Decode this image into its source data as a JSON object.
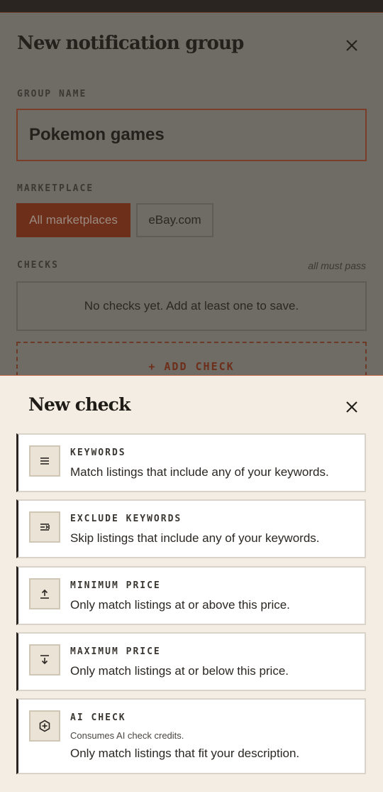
{
  "background_modal": {
    "title": "New notification group",
    "close_icon": "close-icon",
    "group_name_label": "GROUP NAME",
    "group_name_value": "Pokemon games",
    "marketplace_label": "MARKETPLACE",
    "marketplaces": [
      "All marketplaces",
      "eBay.com"
    ],
    "selected_marketplace": "All marketplaces",
    "checks_label": "CHECKS",
    "checks_hint": "all must pass",
    "empty_checks": "No checks yet. Add at least one to save.",
    "add_check": "+ ADD CHECK"
  },
  "sheet": {
    "title": "New check",
    "close_icon": "close-icon",
    "options": [
      {
        "name": "KEYWORDS",
        "description": "Match listings that include any of your keywords.",
        "icon": "list-icon"
      },
      {
        "name": "EXCLUDE KEYWORDS",
        "description": "Skip listings that include any of your keywords.",
        "icon": "exclude-list-icon"
      },
      {
        "name": "MINIMUM PRICE",
        "description": "Only match listings at or above this price.",
        "icon": "arrow-up-bar-icon"
      },
      {
        "name": "MAXIMUM PRICE",
        "description": "Only match listings at or below this price.",
        "icon": "arrow-down-bar-icon"
      },
      {
        "name": "AI CHECK",
        "note": "Consumes AI check credits.",
        "description": "Only match listings that fit your description.",
        "icon": "ai-hexagon-plus-icon"
      }
    ]
  },
  "colors": {
    "accent": "#6d2e1a",
    "sheet_background": "#f3ede3",
    "overlay": "#6f6c66"
  }
}
